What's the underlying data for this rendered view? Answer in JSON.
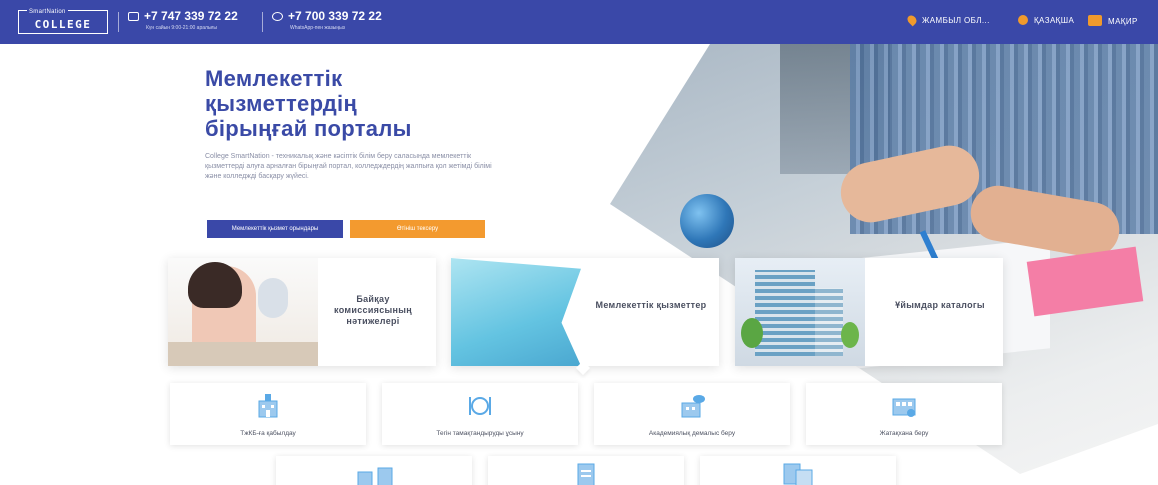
{
  "header": {
    "logo_top": "SmartNation",
    "logo_main": "COLLEGE",
    "phone1": "+7 747 339 72 22",
    "phone1_sub": "Күн сайын 9:00-21:00 аралығы",
    "phone2": "+7 700 339 72 22",
    "phone2_sub": "WhatsApp-пен жазыңыз",
    "region": "ЖАМБЫЛ ОБЛ...",
    "language": "ҚАЗАҚША",
    "login": "МАҚИР"
  },
  "hero": {
    "title_lines": [
      "Мемлекеттік",
      "қызметтердің",
      "бірыңғай порталы"
    ],
    "description": "College SmartNation - техникалық және кәсіптік білім беру саласында мемлекеттік қызметтерді алуға арналған бірыңғай портал, колледждердің жалпыға қол жетімді білімі және колледжді басқару жүйесі.",
    "btn_primary": "Мемлекеттік қызмет орындары",
    "btn_secondary": "Өтініш тексеру"
  },
  "cards": [
    {
      "label": "Байқау комиссиясының нәтижелері"
    },
    {
      "label": "Мемлекеттік қызметтер"
    },
    {
      "label": "Ұйымдар каталогы"
    }
  ],
  "services": [
    {
      "label": "ТжКБ-ға қабылдау",
      "icon": "school-building-icon"
    },
    {
      "label": "Тегін тамақтандыруды ұсыну",
      "icon": "meal-icon"
    },
    {
      "label": "Академиялық демалыс беру",
      "icon": "building-chat-icon"
    },
    {
      "label": "Жатақхана беру",
      "icon": "dormitory-icon"
    }
  ],
  "services_row2": [
    {
      "icon": "buildings-icon"
    },
    {
      "icon": "document-icon"
    },
    {
      "icon": "documents-icon"
    }
  ],
  "colors": {
    "brand_blue": "#3a48a8",
    "accent_orange": "#f39a2f",
    "icon_blue": "#5aa9e6"
  }
}
